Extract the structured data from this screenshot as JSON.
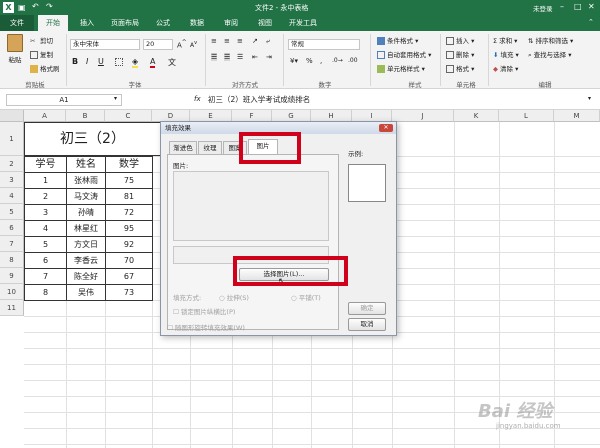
{
  "window": {
    "title": "文件2 - 永中表格",
    "user": "未登录"
  },
  "tabs": [
    "文件",
    "开始",
    "插入",
    "页面布局",
    "公式",
    "数据",
    "审阅",
    "视图",
    "开发工具"
  ],
  "ribbon": {
    "paste": "粘贴",
    "cut": "剪切",
    "copy": "复制",
    "format_painter": "格式刷",
    "font_name": "永中宋体",
    "font_size": "20",
    "number_format": "常规",
    "conditional_format": "条件格式 ▾",
    "auto_table_format": "自动套用格式 ▾",
    "cell_style": "单元格样式 ▾",
    "insert": "插入 ▾",
    "delete": "删除 ▾",
    "format": "格式 ▾",
    "sum": "求和 ▾",
    "fill": "填充 ▾",
    "clear": "清除 ▾",
    "sort_filter": "排序和筛选 ▾",
    "find_select": "查找与选择 ▾",
    "groups": [
      "剪贴板",
      "字体",
      "对齐方式",
      "数字",
      "样式",
      "单元格",
      "编辑"
    ]
  },
  "formula_bar": {
    "name_box": "A1",
    "fx": "fx",
    "content": "初三（2）班入学考试成绩排名"
  },
  "columns": [
    "A",
    "B",
    "C",
    "D",
    "E",
    "F",
    "G",
    "H",
    "I",
    "J",
    "K",
    "L",
    "M"
  ],
  "rows": [
    "1",
    "2",
    "3",
    "4",
    "5",
    "6",
    "7",
    "8",
    "9",
    "10",
    "11"
  ],
  "sheet": {
    "title": "初三（2）",
    "headers": [
      "学号",
      "姓名",
      "数学"
    ],
    "data": [
      [
        "1",
        "张林雨",
        "75"
      ],
      [
        "2",
        "马文涛",
        "81"
      ],
      [
        "3",
        "孙晴",
        "72"
      ],
      [
        "4",
        "林星红",
        "95"
      ],
      [
        "5",
        "方文日",
        "92"
      ],
      [
        "6",
        "李香云",
        "70"
      ],
      [
        "7",
        "陈全好",
        "67"
      ],
      [
        "8",
        "吴伟",
        "73"
      ]
    ]
  },
  "dialog": {
    "title": "填充效果",
    "close": "✕",
    "tabs": [
      "渐进色",
      "纹理",
      "图案",
      "图片"
    ],
    "active_tab": "图片",
    "picture_label": "图片:",
    "sample_label": "示例:",
    "select_picture": "选择图片(L)...",
    "fill_mode_label": "填充方式:",
    "stretch": "拉伸(S)",
    "tile": "平铺(T)",
    "lock_aspect": "锁定图片纵横比(P)",
    "rotate_with_shape": "随图形旋转填充效果(W)",
    "ok": "确定",
    "cancel": "取消"
  },
  "watermark": "Bai 经验",
  "watermark_url": "jingyan.baidu.com"
}
